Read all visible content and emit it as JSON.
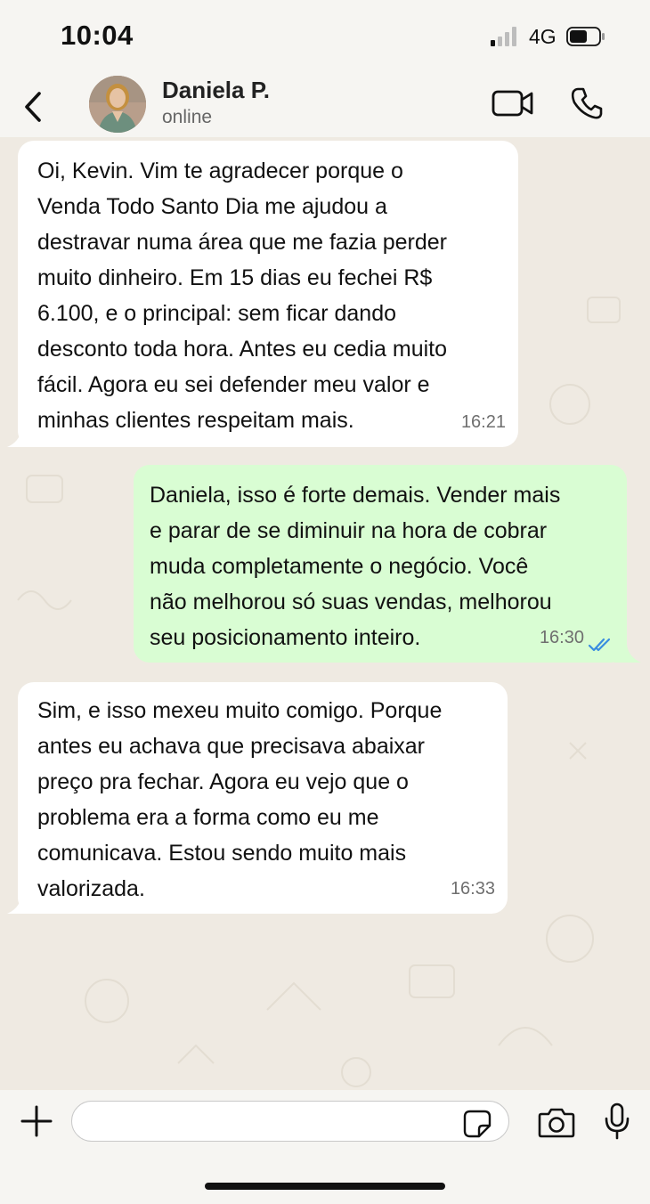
{
  "status_bar": {
    "time": "10:04",
    "network": "4G"
  },
  "header": {
    "contact_name": "Daniela P.",
    "contact_status": "online"
  },
  "messages": [
    {
      "direction": "incoming",
      "lines": [
        "Oi, Kevin. Vim te agradecer porque o",
        "Venda Todo Santo Dia me ajudou a",
        "destravar numa área que me fazia perder",
        "muito dinheiro. Em 15 dias eu fechei R$",
        "6.100, e o principal: sem ficar dando",
        "desconto toda hora. Antes eu cedia muito",
        "fácil. Agora eu sei defender meu valor e",
        "minhas clientes respeitam mais."
      ],
      "time": "16:21"
    },
    {
      "direction": "outgoing",
      "lines": [
        "Daniela, isso é forte demais. Vender mais",
        "e parar de se diminuir na hora de cobrar",
        "muda completamente o negócio. Você",
        "não melhorou só suas vendas, melhorou",
        "seu posicionamento inteiro."
      ],
      "time": "16:30",
      "read": true
    },
    {
      "direction": "incoming",
      "lines": [
        "Sim, e isso mexeu muito comigo. Porque",
        "antes eu achava que precisava abaixar",
        "preço pra fechar. Agora eu vejo que o",
        "problema era a forma como eu me",
        "comunicava. Estou sendo muito mais",
        "valorizada."
      ],
      "time": "16:33"
    }
  ],
  "input": {
    "placeholder": ""
  },
  "colors": {
    "incoming_bubble": "#ffffff",
    "outgoing_bubble": "#d9fdd3",
    "read_ticks": "#3a8de0",
    "chat_background": "#efeae2"
  }
}
